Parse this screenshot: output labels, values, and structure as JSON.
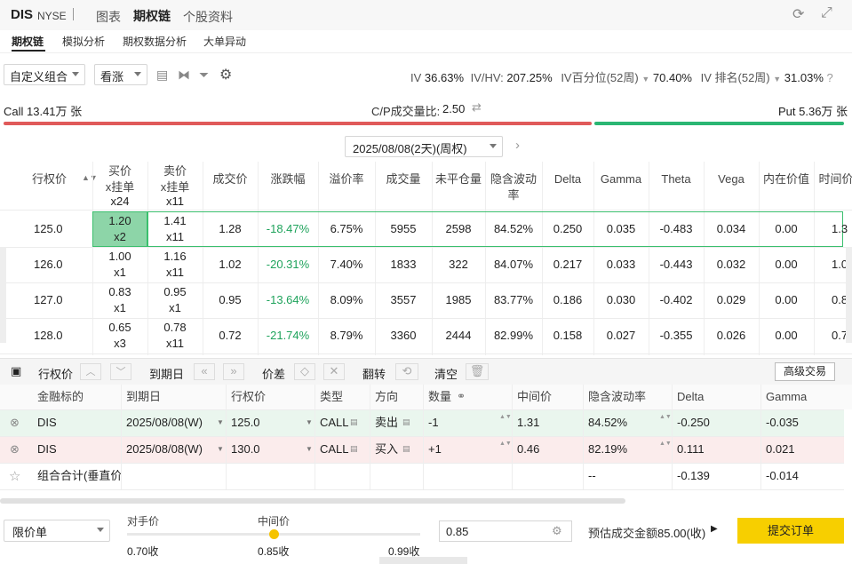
{
  "header": {
    "symbol": "DIS",
    "exchange": "NYSE",
    "tabs": [
      "图表",
      "期权链",
      "个股资料"
    ],
    "active_tab": "期权链"
  },
  "subtabs": {
    "items": [
      "期权链",
      "模拟分析",
      "期权数据分析",
      "大单异动"
    ],
    "active": "期权链"
  },
  "toolbar": {
    "combo": "自定义组合",
    "direction": "看涨",
    "stats": {
      "iv_label": "IV",
      "iv": "36.63%",
      "ivhv_label": "IV/HV:",
      "ivhv": "207.25%",
      "ivpct_label": "IV百分位(52周)",
      "ivpct": "70.40%",
      "ivrank_label": "IV 排名(52周)",
      "ivrank": "31.03%"
    }
  },
  "volume": {
    "call_label": "Call 13.41万 张",
    "ratio_label": "C/P成交量比:",
    "ratio": "2.50",
    "put_label": "Put 5.36万 张",
    "call_color": "#e05a5a",
    "put_color": "#2bb673"
  },
  "expiry": {
    "selected": "2025/08/08(2天)(周权)"
  },
  "chain": {
    "headers": [
      "行权价",
      "买价\nx挂单",
      "卖价\nx挂单",
      "成交价",
      "涨跌幅",
      "溢价率",
      "成交量",
      "未平仓量",
      "隐含波动率",
      "Delta",
      "Gamma",
      "Theta",
      "Vega",
      "内在价值",
      "时间价"
    ],
    "partial_row": {
      "bid_size": "x24",
      "ask_size": "x11"
    },
    "rows": [
      {
        "strike": "125.0",
        "bid": "1.20",
        "bid_size": "x2",
        "ask": "1.41",
        "ask_size": "x11",
        "last": "1.28",
        "chg": "-18.47%",
        "premium": "6.75%",
        "vol": "5955",
        "oi": "2598",
        "iv": "84.52%",
        "delta": "0.250",
        "gamma": "0.035",
        "theta": "-0.483",
        "vega": "0.034",
        "intrinsic": "0.00",
        "timeval": "1.3"
      },
      {
        "strike": "126.0",
        "bid": "1.00",
        "bid_size": "x1",
        "ask": "1.16",
        "ask_size": "x11",
        "last": "1.02",
        "chg": "-20.31%",
        "premium": "7.40%",
        "vol": "1833",
        "oi": "322",
        "iv": "84.07%",
        "delta": "0.217",
        "gamma": "0.033",
        "theta": "-0.443",
        "vega": "0.032",
        "intrinsic": "0.00",
        "timeval": "1.0"
      },
      {
        "strike": "127.0",
        "bid": "0.83",
        "bid_size": "x1",
        "ask": "0.95",
        "ask_size": "x1",
        "last": "0.95",
        "chg": "-13.64%",
        "premium": "8.09%",
        "vol": "3557",
        "oi": "1985",
        "iv": "83.77%",
        "delta": "0.186",
        "gamma": "0.030",
        "theta": "-0.402",
        "vega": "0.029",
        "intrinsic": "0.00",
        "timeval": "0.8"
      },
      {
        "strike": "128.0",
        "bid": "0.65",
        "bid_size": "x3",
        "ask": "0.78",
        "ask_size": "x11",
        "last": "0.72",
        "chg": "-21.74%",
        "premium": "8.79%",
        "vol": "3360",
        "oi": "2444",
        "iv": "82.99%",
        "delta": "0.158",
        "gamma": "0.027",
        "theta": "-0.355",
        "vega": "0.026",
        "intrinsic": "0.00",
        "timeval": "0.7"
      }
    ]
  },
  "order_toolbar": {
    "strike": "行权价",
    "expiry": "到期日",
    "spread": "价差",
    "flip": "翻转",
    "clear": "清空",
    "advanced": "高级交易"
  },
  "legs": {
    "headers": [
      "金融标的",
      "到期日",
      "行权价",
      "类型",
      "方向",
      "数量",
      "中间价",
      "隐含波动率",
      "Delta",
      "Gamma"
    ],
    "rows": [
      {
        "underlying": "DIS",
        "expiry": "2025/08/08(W)",
        "strike": "125.0",
        "type": "CALL",
        "side": "卖出",
        "qty": "-1",
        "mid": "1.31",
        "iv": "84.52%",
        "delta": "-0.250",
        "gamma": "-0.035"
      },
      {
        "underlying": "DIS",
        "expiry": "2025/08/08(W)",
        "strike": "130.0",
        "type": "CALL",
        "side": "买入",
        "qty": "+1",
        "mid": "0.46",
        "iv": "82.19%",
        "delta": "0.111",
        "gamma": "0.021"
      }
    ],
    "total": {
      "label": "组合合计(垂直价差)",
      "iv": "--",
      "delta": "-0.139",
      "gamma": "-0.014"
    }
  },
  "order": {
    "type": "限价单",
    "opp_label": "对手价",
    "mid_label": "中间价",
    "opp": "0.70收",
    "mid": "0.85收",
    "far": "0.99收",
    "price": "0.85",
    "est_label": "预估成交金额",
    "est": "85.00(收)",
    "submit": "提交订单",
    "slider_fraction": 0.5
  }
}
